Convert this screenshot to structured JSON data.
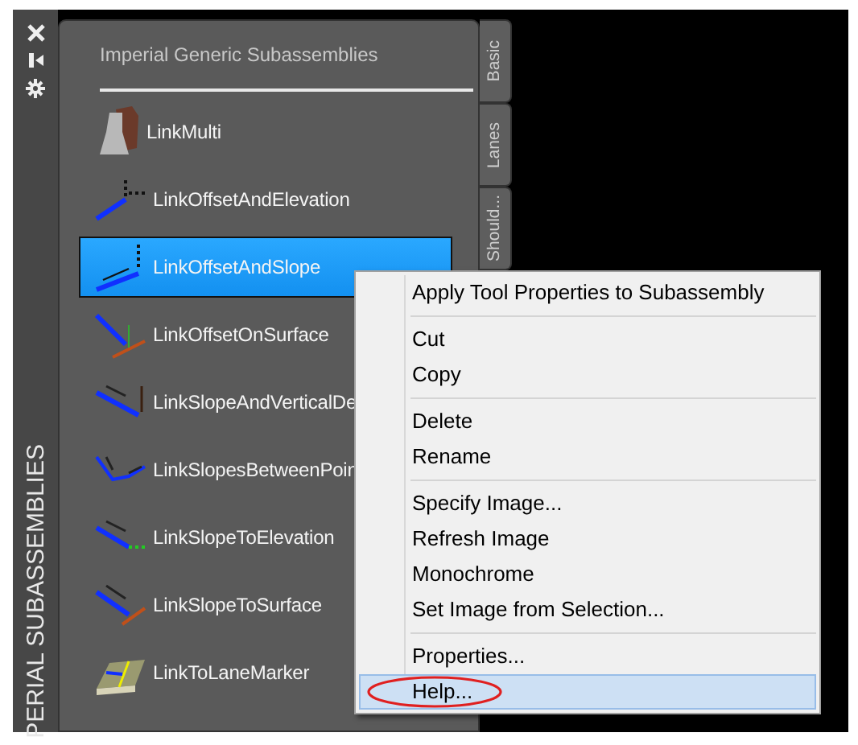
{
  "palette": {
    "side_title": "PERIAL SUBASSEMBLIES",
    "heading": "Imperial Generic Subassemblies",
    "items": [
      {
        "label": "LinkMulti",
        "selected": false
      },
      {
        "label": "LinkOffsetAndElevation",
        "selected": false
      },
      {
        "label": "LinkOffsetAndSlope",
        "selected": true
      },
      {
        "label": "LinkOffsetOnSurface",
        "selected": false
      },
      {
        "label": "LinkSlopeAndVerticalDe",
        "selected": false
      },
      {
        "label": "LinkSlopesBetweenPoin",
        "selected": false
      },
      {
        "label": "LinkSlopeToElevation",
        "selected": false
      },
      {
        "label": "LinkSlopeToSurface",
        "selected": false
      },
      {
        "label": "LinkToLaneMarker",
        "selected": false
      }
    ],
    "tabs": [
      {
        "label": "Basic",
        "selected": false
      },
      {
        "label": "Lanes",
        "selected": false
      },
      {
        "label": "Should...",
        "selected": false
      }
    ]
  },
  "context_menu": {
    "groups": [
      [
        {
          "label": "Apply Tool Properties to Subassembly",
          "selected": false,
          "circled": false
        }
      ],
      [
        {
          "label": "Cut",
          "selected": false,
          "circled": false
        },
        {
          "label": "Copy",
          "selected": false,
          "circled": false
        }
      ],
      [
        {
          "label": "Delete",
          "selected": false,
          "circled": false
        },
        {
          "label": "Rename",
          "selected": false,
          "circled": false
        }
      ],
      [
        {
          "label": "Specify Image...",
          "selected": false,
          "circled": false
        },
        {
          "label": "Refresh Image",
          "selected": false,
          "circled": false
        },
        {
          "label": "Monochrome",
          "selected": false,
          "circled": false
        },
        {
          "label": "Set Image from Selection...",
          "selected": false,
          "circled": false
        }
      ],
      [
        {
          "label": "Properties...",
          "selected": false,
          "circled": false
        },
        {
          "label": "Help...",
          "selected": true,
          "circled": true
        }
      ]
    ]
  }
}
